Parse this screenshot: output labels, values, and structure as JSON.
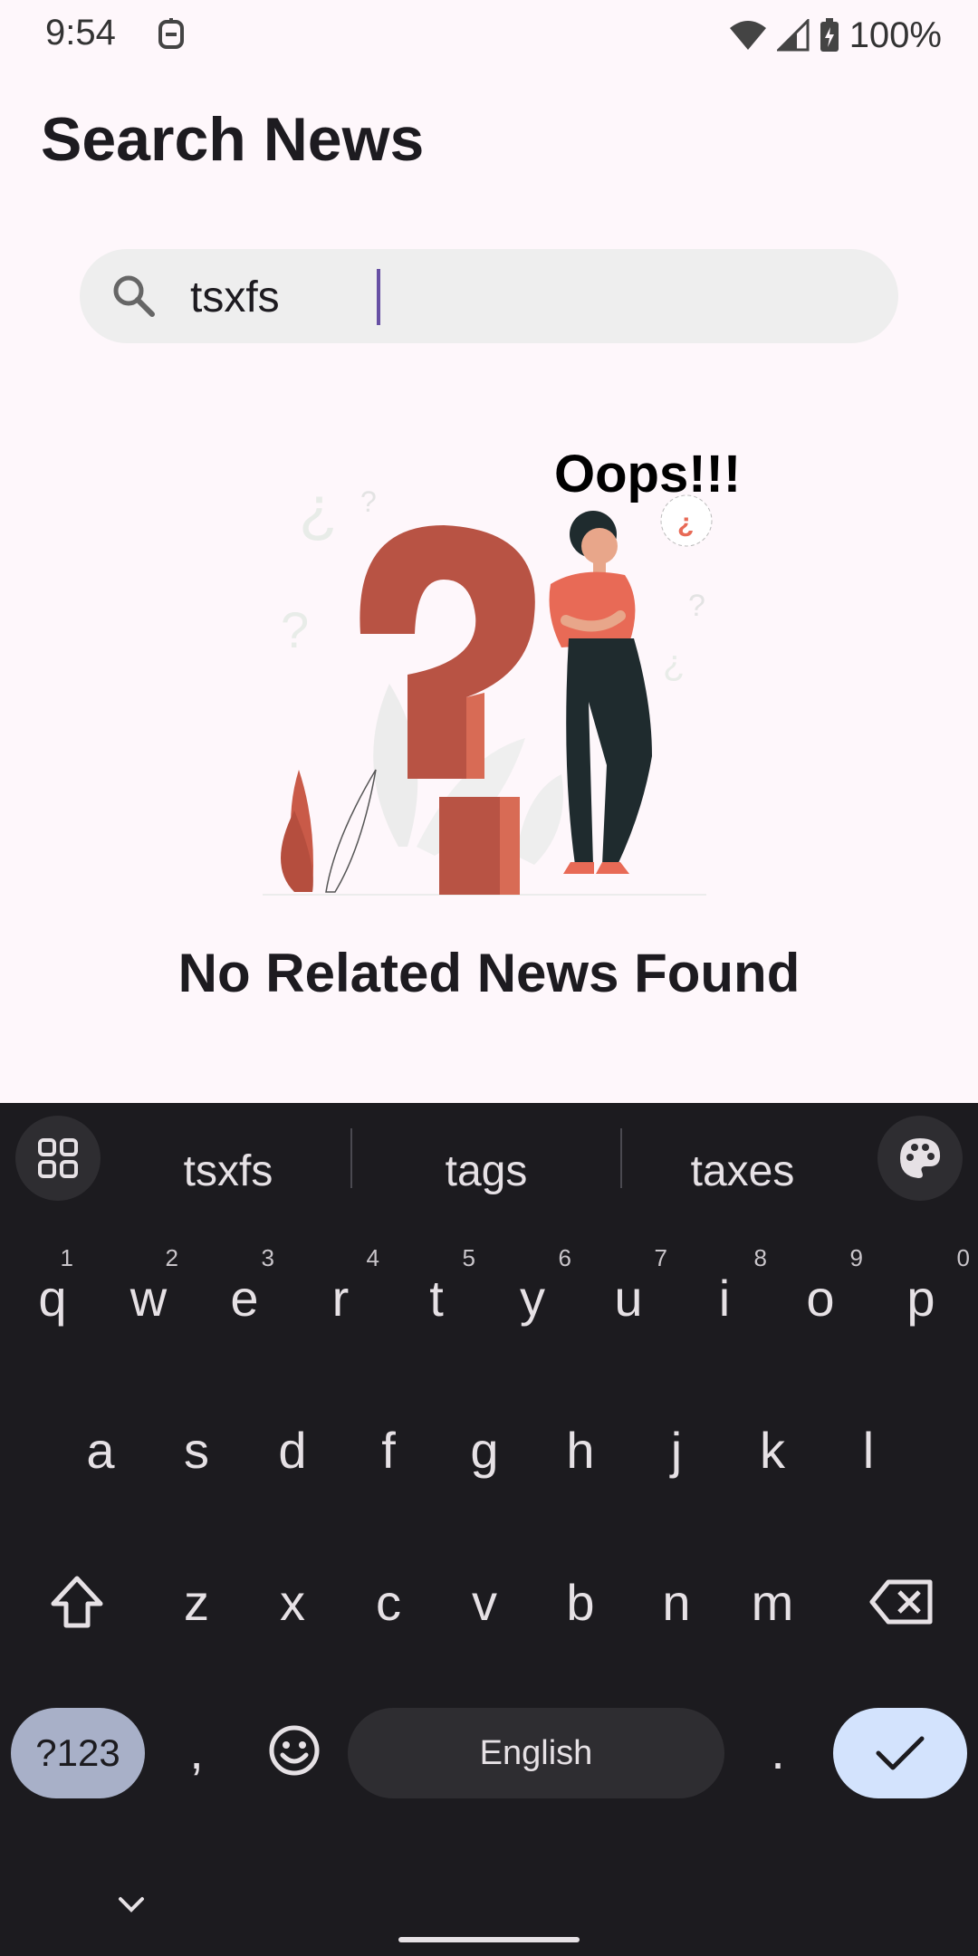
{
  "status_bar": {
    "time": "9:54",
    "battery": "100%"
  },
  "header": {
    "title": "Search News"
  },
  "search": {
    "value": "tsxfs",
    "placeholder": ""
  },
  "empty_state": {
    "oops": "Oops!!!",
    "message": "No Related News Found"
  },
  "keyboard": {
    "suggestions": [
      "tsxfs",
      "tags",
      "taxes"
    ],
    "row1": [
      {
        "label": "q",
        "hint": "1"
      },
      {
        "label": "w",
        "hint": "2"
      },
      {
        "label": "e",
        "hint": "3"
      },
      {
        "label": "r",
        "hint": "4"
      },
      {
        "label": "t",
        "hint": "5"
      },
      {
        "label": "y",
        "hint": "6"
      },
      {
        "label": "u",
        "hint": "7"
      },
      {
        "label": "i",
        "hint": "8"
      },
      {
        "label": "o",
        "hint": "9"
      },
      {
        "label": "p",
        "hint": "0"
      }
    ],
    "row2": [
      "a",
      "s",
      "d",
      "f",
      "g",
      "h",
      "j",
      "k",
      "l"
    ],
    "row3": [
      "z",
      "x",
      "c",
      "v",
      "b",
      "n",
      "m"
    ],
    "symbols_label": "?123",
    "comma": ",",
    "space_label": "English",
    "period": "."
  },
  "colors": {
    "accent": "#6750A4",
    "question_mark": "#B85344",
    "keyboard_bg": "#1C1B1F",
    "enter_key": "#D3E3FD",
    "symbols_key": "#A8B0C8"
  }
}
